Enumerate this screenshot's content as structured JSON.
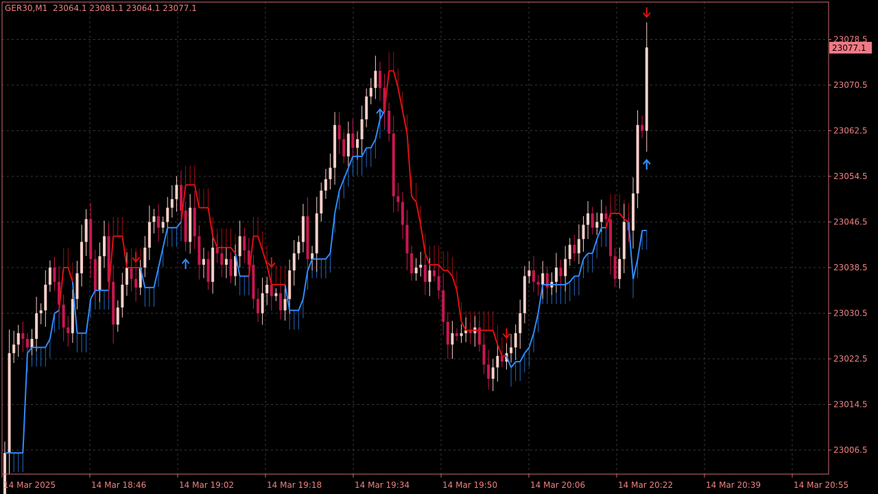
{
  "header": {
    "symbol": "GER30,M1",
    "ohlc": "23064.1 23081.1 23064.1 23077.1"
  },
  "colors": {
    "background": "#000000",
    "frame": "#d06a72",
    "grid": "#3a3a3a",
    "text": "#f08080",
    "bull_candle": "#f8d0c8",
    "bear_candle": "#c8174f",
    "trend_up": "#2f8cff",
    "trend_down": "#e01010",
    "price_tag_bg": "#f07a86"
  },
  "chart_data": {
    "type": "candlestick",
    "ylim": [
      23002.5,
      23082.5
    ],
    "y_ticks": [
      "23078.5",
      "23070.5",
      "23062.5",
      "23054.5",
      "23046.5",
      "23038.5",
      "23030.5",
      "23022.5",
      "23014.5",
      "23006.5"
    ],
    "x_ticks": [
      "14 Mar 2025",
      "14 Mar 18:46",
      "14 Mar 19:02",
      "14 Mar 19:18",
      "14 Mar 19:34",
      "14 Mar 19:50",
      "14 Mar 20:06",
      "14 Mar 20:22",
      "14 Mar 20:39",
      "14 Mar 20:55"
    ],
    "current_price": "23077.1",
    "grid": true,
    "series": [
      {
        "type": "candles",
        "closes": [
          23006.0,
          23023.5,
          23025.0,
          23027.0,
          23026.0,
          23024.5,
          23026.0,
          23030.5,
          23031.0,
          23035.5,
          23038.5,
          23036.0,
          23032.0,
          23028.0,
          23027.0,
          23033.0,
          23037.5,
          23043.0,
          23047.0,
          23040.0,
          23034.5,
          23040.5,
          23044.0,
          23036.0,
          23028.5,
          23031.5,
          23035.5,
          23038.5,
          23036.5,
          23035.0,
          23038.5,
          23042.0,
          23046.5,
          23047.5,
          23045.5,
          23046.5,
          23049.0,
          23050.5,
          23053.0,
          23048.5,
          23043.0,
          23049.0,
          23044.0,
          23039.0,
          23040.0,
          23036.0,
          23042.0,
          23041.0,
          23039.0,
          23040.0,
          23037.0,
          23040.5,
          23044.0,
          23041.5,
          23039.0,
          23033.0,
          23030.5,
          23034.0,
          23035.5,
          23033.5,
          23034.0,
          23031.0,
          23033.0,
          23038.0,
          23041.0,
          23043.0,
          23047.5,
          23040.0,
          23041.0,
          23048.0,
          23052.0,
          23054.0,
          23056.0,
          23063.5,
          23061.0,
          23058.0,
          23062.0,
          23059.5,
          23061.0,
          23064.5,
          23068.5,
          23070.0,
          23073.0,
          23070.0,
          23066.0,
          23062.0,
          23051.0,
          23050.0,
          23046.0,
          23041.0,
          23037.5,
          23038.5,
          23039.0,
          23036.0,
          23038.0,
          23037.0,
          23034.5,
          23029.0,
          23025.0,
          23027.0,
          23026.5,
          23027.0,
          23027.5,
          23027.0,
          23028.0,
          23025.0,
          23021.5,
          23019.0,
          23021.0,
          23023.0,
          23022.0,
          23023.5,
          23024.5,
          23027.0,
          23030.5,
          23037.0,
          23038.0,
          23036.0,
          23035.5,
          23037.5,
          23035.0,
          23036.0,
          23038.5,
          23037.0,
          23040.0,
          23042.5,
          23041.0,
          23043.5,
          23046.0,
          23048.0,
          23045.5,
          23046.5,
          23048.0,
          23047.0,
          23040.5,
          23036.5,
          23040.0,
          23046.5,
          23045.0,
          23051.5,
          23063.5,
          23062.5,
          23077.1
        ]
      },
      {
        "type": "trend_line",
        "up_color": "trend_up",
        "down_color": "trend_down"
      }
    ],
    "signals": [
      {
        "direction": "down",
        "bar": 29
      },
      {
        "direction": "down",
        "bar": 59
      },
      {
        "direction": "down",
        "bar": 111
      },
      {
        "direction": "down",
        "bar": 173
      },
      {
        "direction": "up",
        "bar": 40
      },
      {
        "direction": "up",
        "bar": 83
      },
      {
        "direction": "up",
        "bar": 142
      },
      {
        "direction": "up",
        "bar": 181
      }
    ]
  }
}
